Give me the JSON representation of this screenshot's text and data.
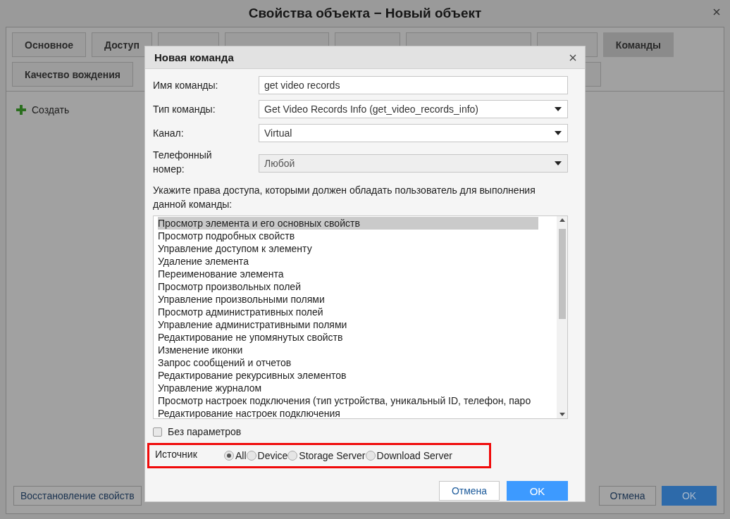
{
  "window": {
    "title": "Свойства объекта − Новый объект"
  },
  "tabs": [
    [
      {
        "label": "Основное",
        "selected": false
      },
      {
        "label": "Доступ",
        "selected": false
      },
      {
        "label": "Команды",
        "selected": true
      }
    ],
    [
      {
        "label": "Качество вождения",
        "selected": false
      }
    ]
  ],
  "create_button": "Создать",
  "footer": {
    "restore_button": "Восстановление свойств",
    "cancel_button": "Отмена",
    "ok_button": "OK"
  },
  "dialog": {
    "title": "Новая команда",
    "fields": [
      {
        "kind": "text",
        "label": "Имя команды:",
        "value": "get video records",
        "disabled": false
      },
      {
        "kind": "select",
        "label": "Тип команды:",
        "value": "Get Video Records Info (get_video_records_info)",
        "disabled": false
      },
      {
        "kind": "select",
        "label": "Канал:",
        "value": "Virtual",
        "disabled": false
      },
      {
        "kind": "select",
        "label": "Телефонный номер:",
        "value": "Любой",
        "disabled": true
      }
    ],
    "rights_label": "Укажите права доступа, которыми должен обладать пользователь для выполнения данной команды:",
    "rights": [
      {
        "label": "Просмотр элемента и его основных свойств",
        "selected": true
      },
      {
        "label": "Просмотр подробных свойств",
        "selected": false
      },
      {
        "label": "Управление доступом к элементу",
        "selected": false
      },
      {
        "label": "Удаление элемента",
        "selected": false
      },
      {
        "label": "Переименование элемента",
        "selected": false
      },
      {
        "label": "Просмотр произвольных полей",
        "selected": false
      },
      {
        "label": "Управление произвольными полями",
        "selected": false
      },
      {
        "label": "Просмотр административных полей",
        "selected": false
      },
      {
        "label": "Управление административными полями",
        "selected": false
      },
      {
        "label": "Редактирование не упомянутых свойств",
        "selected": false
      },
      {
        "label": "Изменение иконки",
        "selected": false
      },
      {
        "label": "Запрос сообщений и отчетов",
        "selected": false
      },
      {
        "label": "Редактирование рекурсивных элементов",
        "selected": false
      },
      {
        "label": "Управление журналом",
        "selected": false
      },
      {
        "label": "Просмотр настроек подключения (тип устройства, уникальный ID, телефон, паро",
        "selected": false
      },
      {
        "label": "Редактирование настроек подключения",
        "selected": false
      }
    ],
    "no_params": {
      "label": "Без параметров",
      "checked": false
    },
    "source": {
      "label": "Источник",
      "options": [
        {
          "label": "All",
          "selected": true
        },
        {
          "label": "Device",
          "selected": false
        },
        {
          "label": "Storage Server",
          "selected": false
        },
        {
          "label": "Download Server",
          "selected": false
        }
      ]
    },
    "cancel_button": "Отмена",
    "ok_button": "OK"
  }
}
